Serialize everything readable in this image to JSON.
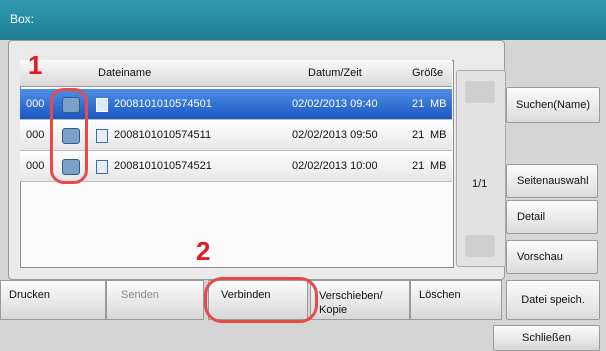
{
  "title_bar": {
    "title": "Box:"
  },
  "list": {
    "columns": {
      "name": "Dateiname",
      "date": "Datum/Zeit",
      "size": "Größe"
    },
    "rows": [
      {
        "index": "000",
        "name": "2008101010574501",
        "date": "02/02/2013 09:40",
        "size": "21",
        "unit": "MB",
        "selected": true
      },
      {
        "index": "000",
        "name": "2008101010574511",
        "date": "02/02/2013 09:50",
        "size": "21",
        "unit": "MB",
        "selected": false
      },
      {
        "index": "000",
        "name": "2008101010574521",
        "date": "02/02/2013 10:00",
        "size": "21",
        "unit": "MB",
        "selected": false
      }
    ],
    "page_indicator": "1/1"
  },
  "right_buttons": {
    "search": "Suchen(Name)",
    "page_select": "Seitenauswahl",
    "detail": "Detail",
    "preview": "Vorschau",
    "save_file": "Datei speich."
  },
  "bottom_buttons": {
    "print": "Drucken",
    "send": "Senden",
    "join": "Verbinden",
    "move_copy": "Verschieben/ Kopie",
    "delete": "Löschen"
  },
  "close_button": "Schließen",
  "callouts": {
    "one": "1",
    "two": "2"
  },
  "colors": {
    "selection": "#1a58c2",
    "callout": "#e31b23",
    "titlebar": "#1f7e95"
  }
}
